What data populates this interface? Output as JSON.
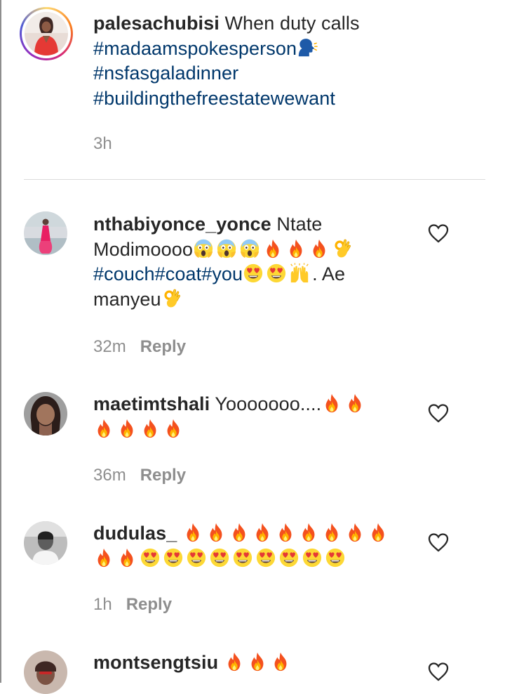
{
  "caption": {
    "username": "palesachubisi",
    "text": " When duty calls",
    "hashtag1": "#madaamspokesperson",
    "hashtag2": "#nsfasgaladinner",
    "hashtag3": "#buildingthefreestatewewant",
    "time": "3h"
  },
  "comments": [
    {
      "username": "nthabiyonce_yonce",
      "text_part1": " Ntate",
      "text_part2": "Modimoooo",
      "hashtag": "#couch#coat#you",
      "text_part3": ". Ae",
      "text_part4": "manyeu",
      "time": "32m",
      "reply_label": "Reply"
    },
    {
      "username": "maetimtshali",
      "text": " Yooooooo....",
      "time": "36m",
      "reply_label": "Reply"
    },
    {
      "username": "dudulas_",
      "time": "1h",
      "reply_label": "Reply"
    },
    {
      "username": "montsengtsiu"
    }
  ],
  "colors": {
    "hashtag": "#00376b",
    "secondary_text": "#8e8e8e",
    "divider": "#dbdbdb"
  },
  "icons": {
    "emoji_set": [
      "face-screaming-emoji",
      "fire-emoji",
      "ok-hand-emoji",
      "heart-eyes-emoji",
      "raising-hands-emoji",
      "speaking-head-emoji"
    ],
    "like": "heart-outline-icon"
  }
}
